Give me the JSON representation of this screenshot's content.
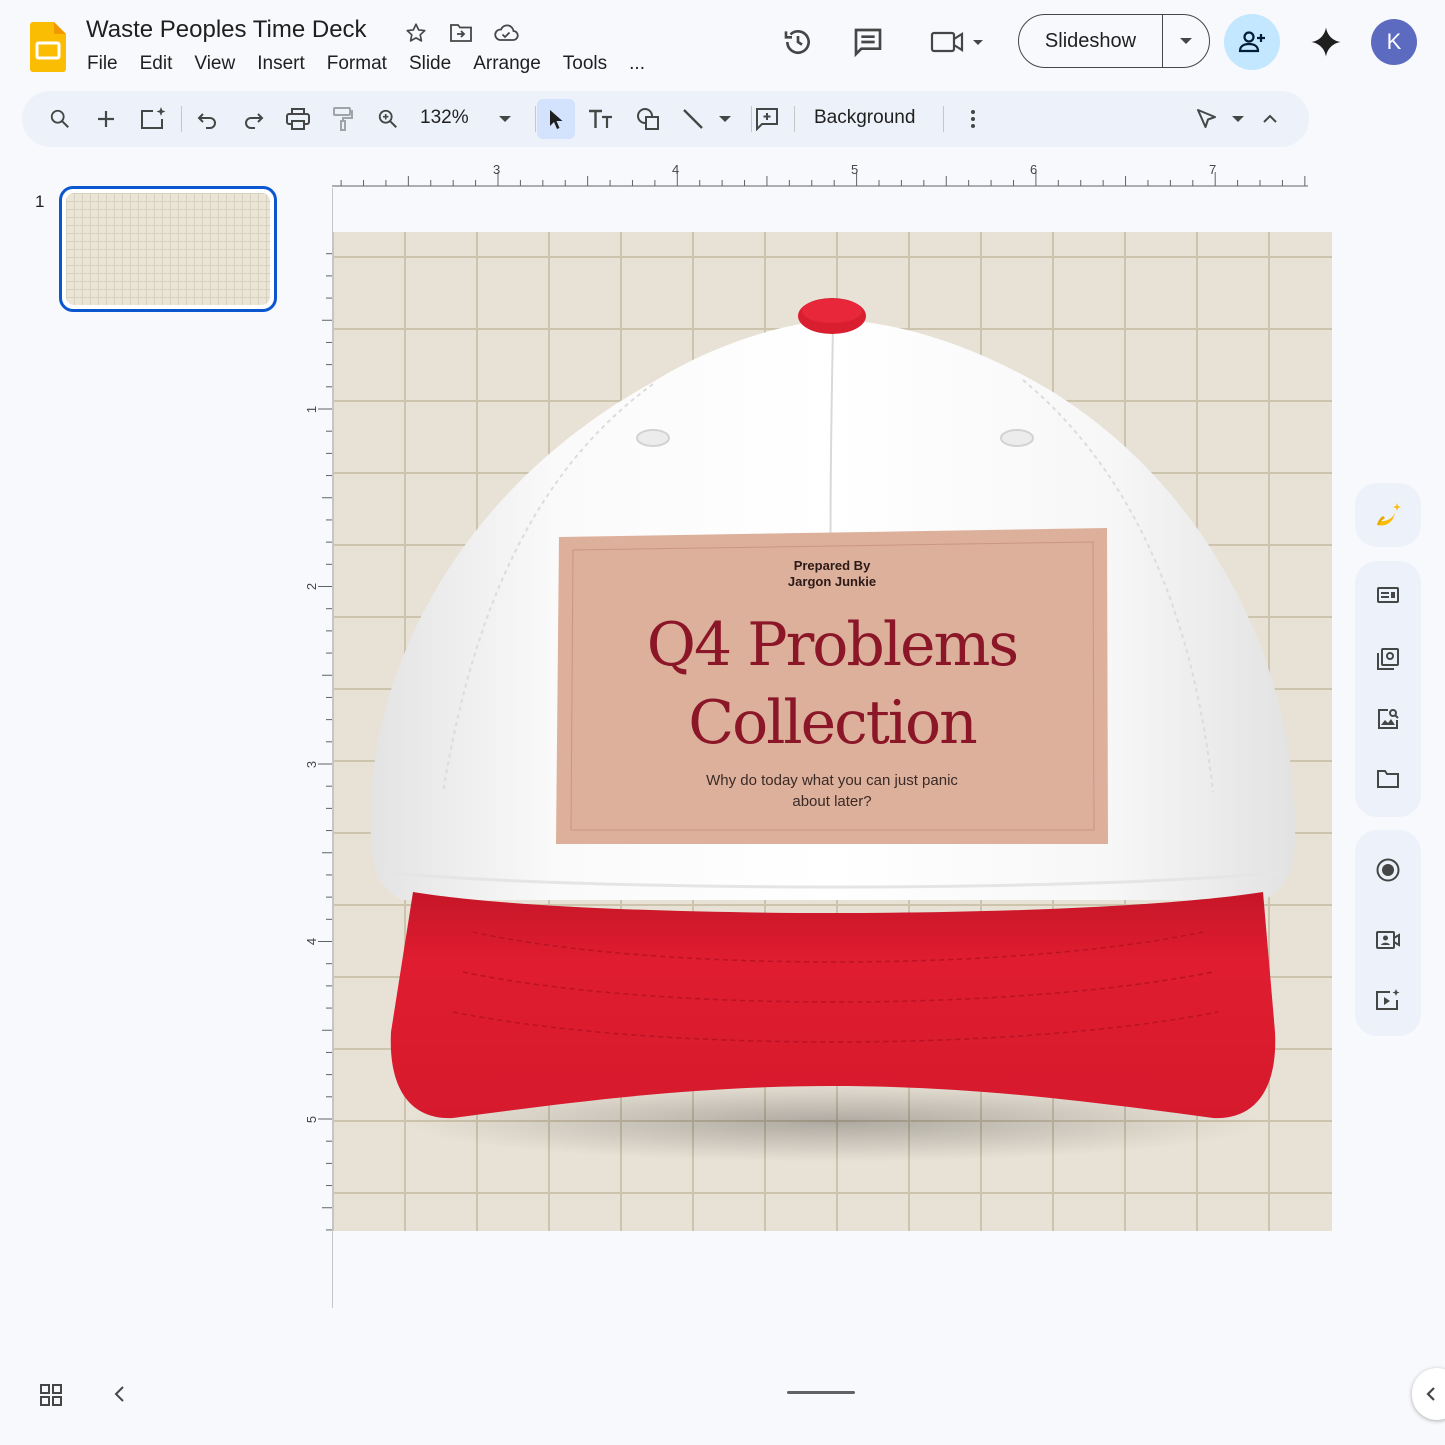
{
  "app": {
    "title": "Waste Peoples Time Deck",
    "menu": [
      "File",
      "Edit",
      "View",
      "Insert",
      "Format",
      "Slide",
      "Arrange",
      "Tools",
      "..."
    ],
    "title_icons": [
      "star-icon",
      "move-folder-icon",
      "cloud-saved-icon"
    ],
    "header_icons": [
      "version-history-icon",
      "comments-icon",
      "meet-camera-icon"
    ],
    "slideshow_label": "Slideshow",
    "avatar_letter": "K",
    "brand_color": "#fbbc04",
    "accent_color": "#0b57d0"
  },
  "toolbar": {
    "zoom": "132%",
    "background_label": "Background",
    "icons": [
      "search-icon",
      "new-slide-icon",
      "ai-slide-icon",
      "undo-icon",
      "redo-icon",
      "print-icon",
      "paint-format-icon",
      "zoom-icon",
      "select-icon",
      "text-box-icon",
      "shape-icon",
      "line-icon",
      "comment-icon",
      "more-icon",
      "pointer-icon",
      "collapse-icon"
    ]
  },
  "filmstrip": {
    "slides": [
      {
        "number": "1",
        "selected": true
      }
    ]
  },
  "ruler": {
    "horizontal": [
      "3",
      "4",
      "5",
      "6",
      "7"
    ],
    "vertical": [
      "1",
      "2",
      "3",
      "4",
      "5"
    ]
  },
  "slide": {
    "background": "#e8e2d6",
    "cap_crown_color": "#ffffff",
    "cap_brim_color": "#d81e2f",
    "label_color": "#ddb09c",
    "label": {
      "prepared_line1": "Prepared By",
      "prepared_line2": "Jargon Junkie",
      "headline_line1": "Q4 Problems",
      "headline_line2": "Collection",
      "tagline_line1": "Why do today what you can just panic",
      "tagline_line2": "about later?"
    }
  },
  "side_panel": {
    "icons": [
      "banana-sparkle-icon",
      "text-layout-icon",
      "image-library-icon",
      "image-search-icon",
      "folder-icon",
      "record-icon",
      "camera-record-icon",
      "video-sparkle-icon"
    ]
  }
}
